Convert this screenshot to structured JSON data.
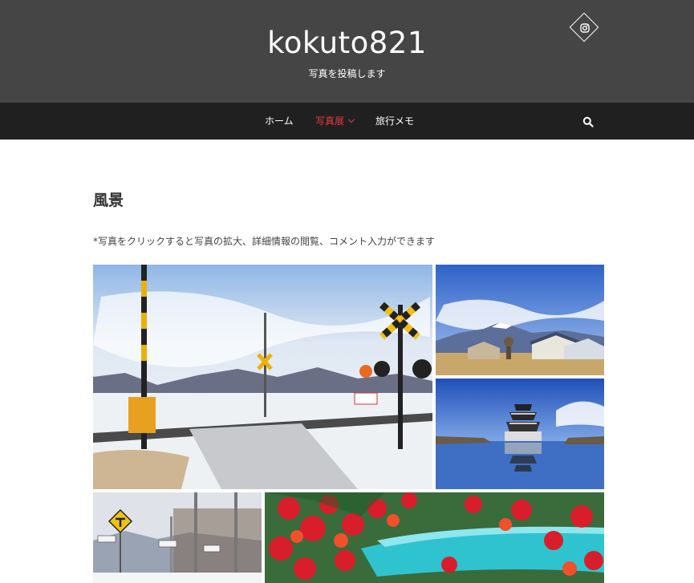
{
  "site": {
    "title": "kokuto821",
    "tagline": "写真を投稿します"
  },
  "social": {
    "icon": "instagram-icon"
  },
  "nav": {
    "items": [
      {
        "label": "ホーム",
        "active": false
      },
      {
        "label": "写真展",
        "active": true,
        "has_dropdown": true
      },
      {
        "label": "旅行メモ",
        "active": false
      }
    ],
    "search_icon": "search-icon"
  },
  "page": {
    "title": "風景",
    "note": "*写真をクリックすると写真の拡大、詳細情報の閲覧、コメント入力ができます"
  },
  "gallery": {
    "items": [
      {
        "subject": "snowy railroad crossing"
      },
      {
        "subject": "houses with mountain under blue sky"
      },
      {
        "subject": "castle reflected in moat"
      },
      {
        "subject": "road with T-junction sign and trees"
      },
      {
        "subject": "red maple leaves"
      }
    ]
  },
  "colors": {
    "header_bg": "#454545",
    "nav_bg": "#202020",
    "accent": "#e8383d"
  }
}
